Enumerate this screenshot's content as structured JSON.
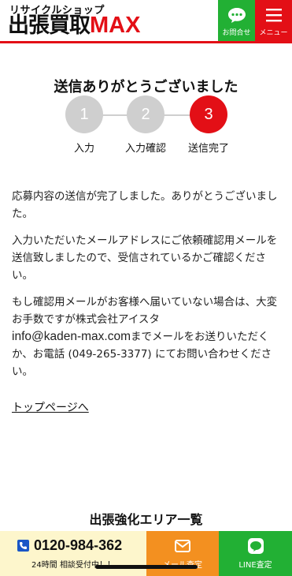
{
  "header": {
    "logo_sub": "リサイクルショップ",
    "logo_main": "出張買取",
    "logo_max": "MAX",
    "contact_label": "お問合せ",
    "menu_label": "メニュー"
  },
  "page": {
    "title": "送信ありがとうございました"
  },
  "steps": [
    {
      "num": "1",
      "label": "入力"
    },
    {
      "num": "2",
      "label": "入力確認"
    },
    {
      "num": "3",
      "label": "送信完了"
    }
  ],
  "content": {
    "p1": "応募内容の送信が完了しました。ありがとうございました。",
    "p2": "入力いただいたメールアドレスにご依頼確認用メールを送信致しましたので、受信されているかご確認ください。",
    "p3a": "もし確認用メールがお客様へ届いていない場合は、大変お手数ですが株式会社アイスタ",
    "email": "info@kaden-max.com",
    "p3b": "までメールをお送りいただくか、お電話 (049-265-3377) にてお問い合わせください。",
    "top_link": "トップページへ"
  },
  "area": {
    "title": "出張強化エリア一覧"
  },
  "bottom_bar": {
    "phone": "0120-984-362",
    "phone_sub": "24時間 相談受付中！！",
    "mail_label": "メール査定",
    "line_label": "LINE査定"
  },
  "colors": {
    "accent_red": "#e30f16",
    "green": "#22b034",
    "orange": "#f39020",
    "step_gray": "#cfcfcf",
    "phone_bg": "#fdf6cc"
  },
  "icons": [
    "chat-bubble-icon",
    "hamburger-menu-icon",
    "phone-icon",
    "mail-icon",
    "line-icon"
  ]
}
